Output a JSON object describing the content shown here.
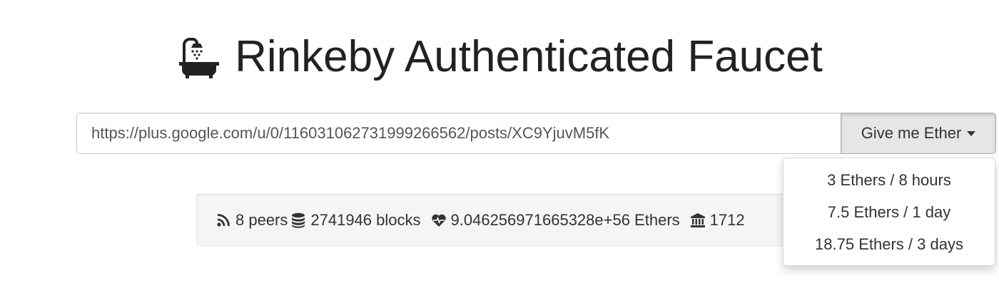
{
  "header": {
    "title": "Rinkeby Authenticated Faucet",
    "icon": "bath-icon"
  },
  "request": {
    "url_value": "https://plus.google.com/u/0/116031062731999266562/posts/XC9YjuvM5fK",
    "button_label": "Give me Ether",
    "options": [
      {
        "label": "3 Ethers / 8 hours"
      },
      {
        "label": "7.5 Ethers / 1 day"
      },
      {
        "label": "18.75 Ethers / 3 days"
      }
    ]
  },
  "stats": {
    "peers": "8 peers",
    "blocks": "2741946 blocks",
    "funds": "9.046256971665328e+56 Ethers",
    "requests": "1712"
  },
  "colors": {
    "text": "#333333",
    "button_bg": "#e6e6e6",
    "well_bg": "#f5f5f5"
  }
}
